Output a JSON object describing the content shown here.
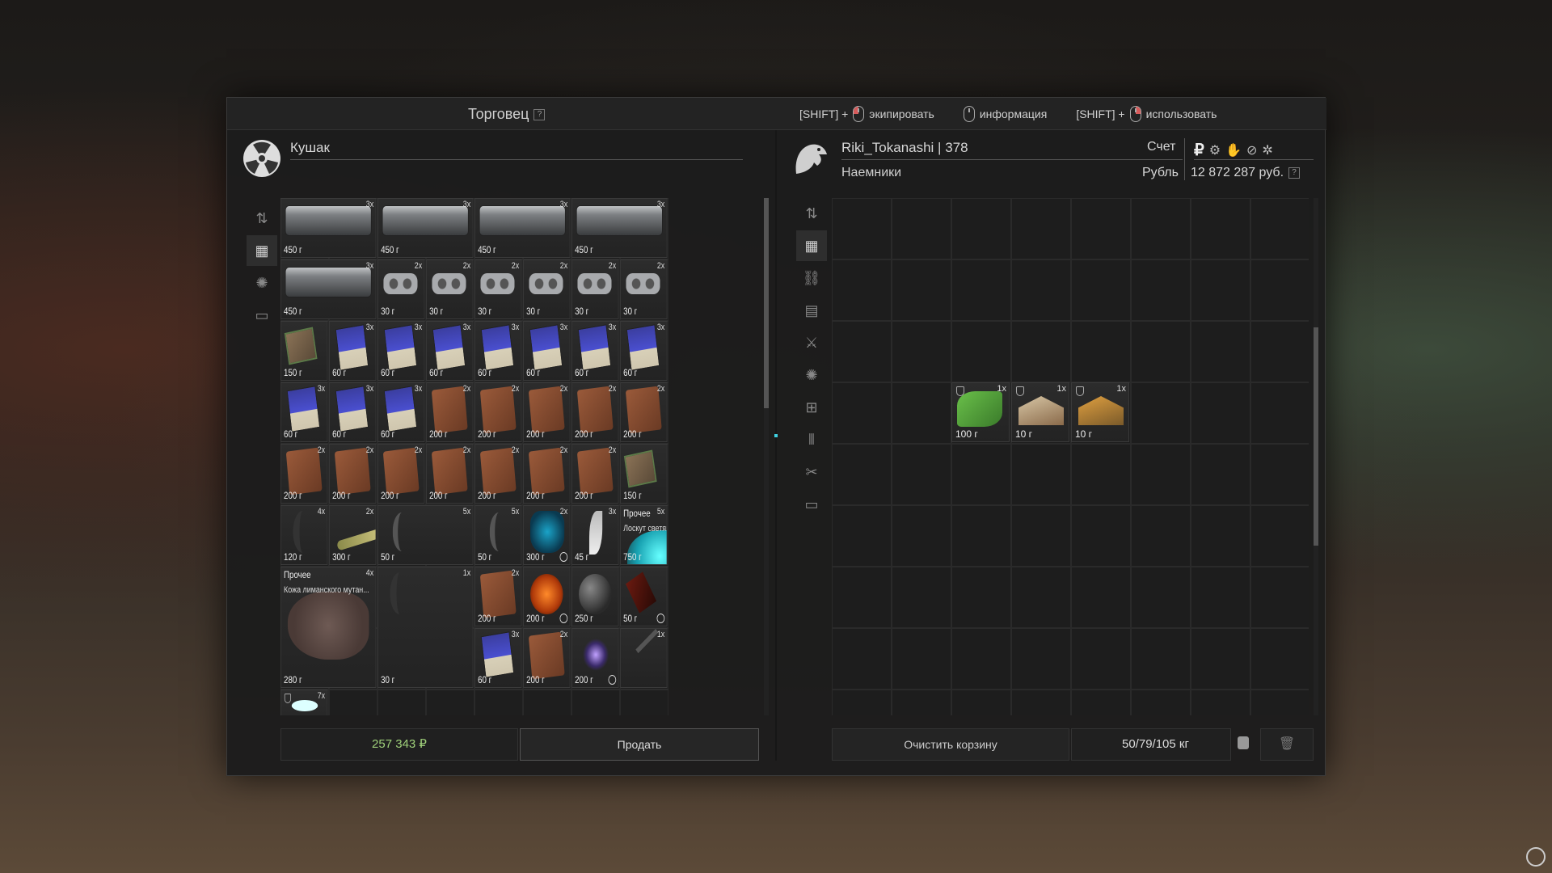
{
  "titlebar": {
    "title": "Торговец",
    "help": "?",
    "hint1_key": "[SHIFT] +",
    "hint1_text": "экипировать",
    "hint2_text": "информация",
    "hint3_key": "[SHIFT] +",
    "hint3_text": "использовать"
  },
  "trader": {
    "name": "Кушак"
  },
  "player": {
    "name": "Riki_Tokanashi | 378",
    "faction": "Наемники",
    "account_label": "Счет",
    "currency_label": "Рубль",
    "balance": "12 872 287 руб."
  },
  "trader_items": [
    {
      "cnt": "3x",
      "price": "450 г",
      "kind": "box"
    },
    {
      "cnt": "3x",
      "price": "450 г",
      "kind": "box"
    },
    {
      "cnt": "3x",
      "price": "450 г",
      "kind": "box"
    },
    {
      "cnt": "3x",
      "price": "450 г",
      "kind": "box"
    },
    {
      "cnt": "3x",
      "price": "450 г",
      "kind": "box"
    },
    {
      "cnt": "2x",
      "price": "30 г",
      "kind": "pad"
    },
    {
      "cnt": "2x",
      "price": "30 г",
      "kind": "pad"
    },
    {
      "cnt": "2x",
      "price": "30 г",
      "kind": "pad"
    },
    {
      "cnt": "2x",
      "price": "30 г",
      "kind": "pad"
    },
    {
      "cnt": "2x",
      "price": "30 г",
      "kind": "pad"
    },
    {
      "cnt": "2x",
      "price": "30 г",
      "kind": "pad"
    },
    {
      "cnt": "",
      "price": "150 г",
      "kind": "chip"
    },
    {
      "cnt": "3x",
      "price": "60 г",
      "kind": "pack"
    },
    {
      "cnt": "3x",
      "price": "60 г",
      "kind": "pack"
    },
    {
      "cnt": "3x",
      "price": "60 г",
      "kind": "pack"
    },
    {
      "cnt": "3x",
      "price": "60 г",
      "kind": "pack"
    },
    {
      "cnt": "3x",
      "price": "60 г",
      "kind": "pack"
    },
    {
      "cnt": "3x",
      "price": "60 г",
      "kind": "pack"
    },
    {
      "cnt": "3x",
      "price": "60 г",
      "kind": "pack"
    },
    {
      "cnt": "3x",
      "price": "60 г",
      "kind": "pack"
    },
    {
      "cnt": "3x",
      "price": "60 г",
      "kind": "pack"
    },
    {
      "cnt": "3x",
      "price": "60 г",
      "kind": "pack"
    },
    {
      "cnt": "2x",
      "price": "200 г",
      "kind": "leather"
    },
    {
      "cnt": "2x",
      "price": "200 г",
      "kind": "leather"
    },
    {
      "cnt": "2x",
      "price": "200 г",
      "kind": "leather"
    },
    {
      "cnt": "2x",
      "price": "200 г",
      "kind": "leather"
    },
    {
      "cnt": "2x",
      "price": "200 г",
      "kind": "leather"
    },
    {
      "cnt": "2x",
      "price": "200 г",
      "kind": "leather"
    },
    {
      "cnt": "2x",
      "price": "200 г",
      "kind": "leather"
    },
    {
      "cnt": "2x",
      "price": "200 г",
      "kind": "leather"
    },
    {
      "cnt": "2x",
      "price": "200 г",
      "kind": "leather"
    },
    {
      "cnt": "2x",
      "price": "200 г",
      "kind": "leather"
    },
    {
      "cnt": "2x",
      "price": "200 г",
      "kind": "leather"
    },
    {
      "cnt": "2x",
      "price": "200 г",
      "kind": "leather"
    },
    {
      "cnt": "",
      "price": "150 г",
      "kind": "chip"
    },
    {
      "cnt": "4x",
      "price": "120 г",
      "kind": "claw"
    },
    {
      "cnt": "2x",
      "price": "300 г",
      "kind": "bone"
    },
    {
      "cnt": "5x",
      "price": "50 г",
      "kind": "hook"
    },
    {
      "cnt": "5x",
      "price": "50 г",
      "kind": "hook"
    },
    {
      "cnt": "2x",
      "price": "300 г",
      "kind": "crystal"
    },
    {
      "cnt": "3x",
      "price": "45 г",
      "kind": "fang"
    },
    {
      "cnt": "5x",
      "price": "750 г",
      "kind": "glow",
      "label": "Прочее",
      "desc": "Лоскут светящейся кож..."
    },
    {
      "cnt": "4x",
      "price": "280 г",
      "kind": "skin",
      "label": "Прочее",
      "desc": "Кожа лиманского мутан..."
    },
    {
      "cnt": "1x",
      "price": "30 г",
      "kind": "claw"
    },
    {
      "cnt": "2x",
      "price": "200 г",
      "kind": "leather"
    },
    {
      "cnt": "",
      "price": "200 г",
      "kind": "fire"
    },
    {
      "cnt": "",
      "price": "250 г",
      "kind": "orb"
    },
    {
      "cnt": "",
      "price": "50 г",
      "kind": "shard"
    },
    {
      "cnt": "3x",
      "price": "60 г",
      "kind": "pack"
    },
    {
      "cnt": "2x",
      "price": "200 г",
      "kind": "leather"
    },
    {
      "cnt": "",
      "price": "200 г",
      "kind": "spark"
    },
    {
      "cnt": "1x",
      "price": "",
      "kind": "knife"
    },
    {
      "cnt": "7x",
      "price": "",
      "kind": "white"
    }
  ],
  "cart_items": [
    {
      "cnt": "1x",
      "price": "100 г",
      "kind": "green"
    },
    {
      "cnt": "1x",
      "price": "10 г",
      "kind": "kitA"
    },
    {
      "cnt": "1x",
      "price": "10 г",
      "kind": "kitB"
    }
  ],
  "footer": {
    "money": "257 343 ₽",
    "sell": "Продать",
    "clear": "Очистить корзину",
    "weight": "50/79/105 кг"
  },
  "colors": {
    "money": "#9fd07a",
    "timer": "#dddddd",
    "accent_red": "#d85a5a"
  }
}
